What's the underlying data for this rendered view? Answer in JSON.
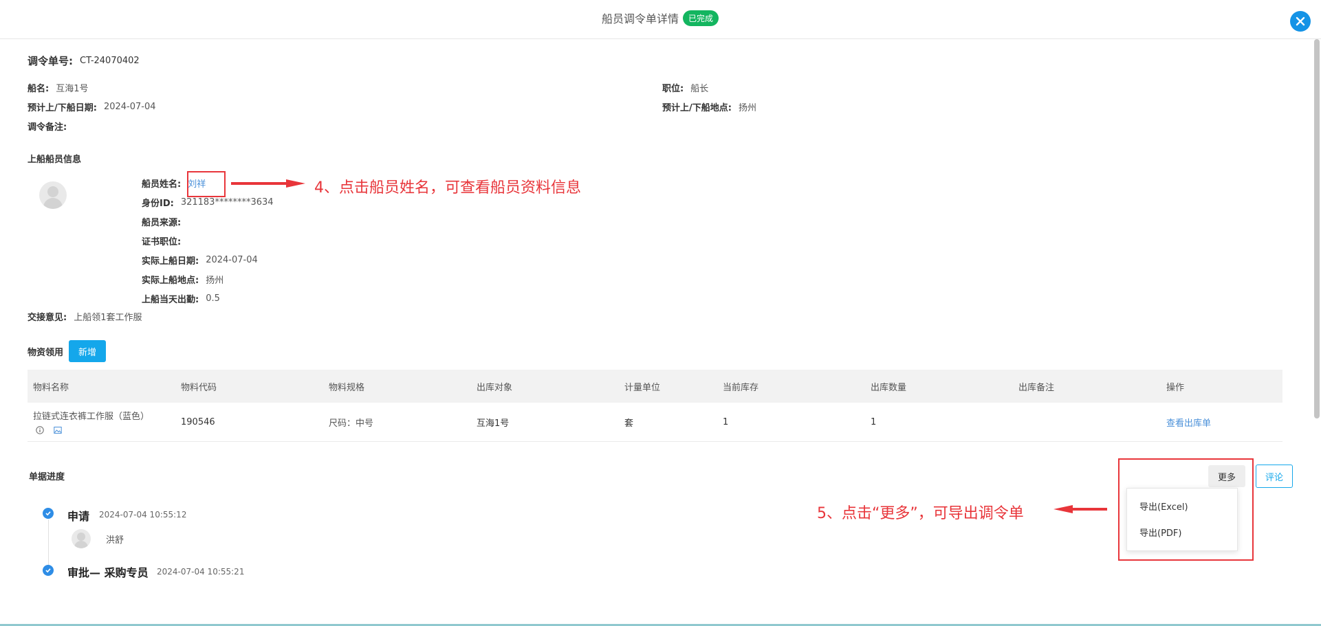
{
  "header": {
    "title": "船员调令单详情",
    "status_badge": "已完成"
  },
  "order": {
    "no_label": "调令单号:",
    "no_value": "CT-24070402",
    "ship_label": "船名:",
    "ship_value": "互海1号",
    "position_label": "职位:",
    "position_value": "船长",
    "date_label": "预计上/下船日期:",
    "date_value": "2024-07-04",
    "place_label": "预计上/下船地点:",
    "place_value": "扬州",
    "remark_label": "调令备注:",
    "remark_value": ""
  },
  "crew": {
    "section_title": "上船船员信息",
    "name_label": "船员姓名:",
    "name_value": "刘祥",
    "id_label": "身份ID:",
    "id_value": "321183********3634",
    "source_label": "船员来源:",
    "source_value": "",
    "cert_label": "证书职位:",
    "cert_value": "",
    "board_date_label": "实际上船日期:",
    "board_date_value": "2024-07-04",
    "board_place_label": "实际上船地点:",
    "board_place_value": "扬州",
    "attendance_label": "上船当天出勤:",
    "attendance_value": "0.5",
    "handover_label": "交接意见:",
    "handover_value": "上船领1套工作服"
  },
  "materials": {
    "section_title": "物资领用",
    "add_button": "新增",
    "columns": [
      "物料名称",
      "物料代码",
      "物料规格",
      "出库对象",
      "计量单位",
      "当前库存",
      "出库数量",
      "出库备注",
      "操作"
    ],
    "rows": [
      {
        "name": "拉链式连衣裤工作服（蓝色）",
        "code": "190546",
        "spec": "尺码：中号",
        "target": "互海1号",
        "unit": "套",
        "stock": "1",
        "qty": "1",
        "remark": "",
        "action": "查看出库单"
      }
    ]
  },
  "progress": {
    "section_title": "单据进度",
    "more_button": "更多",
    "comment_button": "评论",
    "dropdown": [
      "导出(Excel)",
      "导出(PDF)"
    ],
    "steps": [
      {
        "name": "申请",
        "time": "2024-07-04 10:55:12",
        "person": "洪舒"
      },
      {
        "name": "审批— 采购专员",
        "time": "2024-07-04 10:55:21"
      }
    ]
  },
  "annotations": {
    "note4": "4、点击船员姓名，可查看船员资料信息",
    "note5": "5、点击“更多”，可导出调令单"
  },
  "colors": {
    "accent": "#14a7eb",
    "success": "#13b55f",
    "annotation_red": "#e8353a",
    "link": "#4a90d9"
  }
}
